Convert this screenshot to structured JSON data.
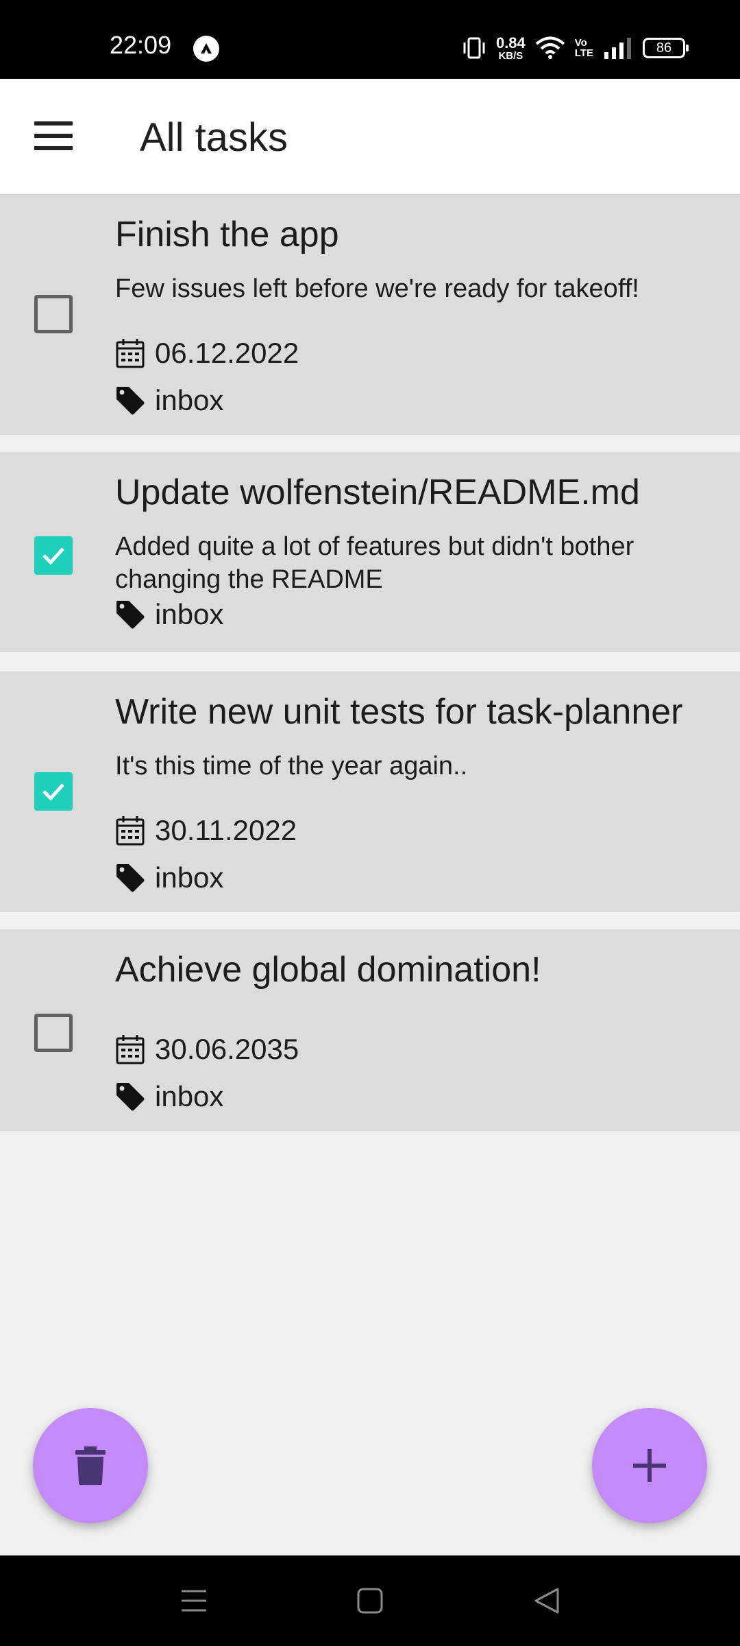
{
  "status_bar": {
    "time": "22:09",
    "net_speed_value": "0.84",
    "net_speed_unit": "KB/S",
    "volte_top": "Vo",
    "volte_bottom": "LTE",
    "battery": "86",
    "icons": [
      "app-notification-icon",
      "vibrate-icon",
      "wifi-icon",
      "signal-icon",
      "battery-icon"
    ]
  },
  "app_bar": {
    "title": "All tasks",
    "menu_icon": "hamburger-menu-icon"
  },
  "tasks": [
    {
      "title": "Finish the app",
      "description": "Few issues left before we're ready for takeoff!",
      "checked": false,
      "date": "06.12.2022",
      "tag": "inbox"
    },
    {
      "title": "Update wolfenstein/README.md",
      "description": "Added quite a lot of features but didn't bother changing the README",
      "checked": true,
      "tag": "inbox"
    },
    {
      "title": "Write new unit tests for task-planner",
      "description": "It's this time of the year again..",
      "checked": true,
      "date": "30.11.2022",
      "tag": "inbox"
    },
    {
      "title": "Achieve global domination!",
      "checked": false,
      "date": "30.06.2035",
      "tag": "inbox"
    }
  ],
  "fabs": {
    "delete_icon": "trash-icon",
    "add_icon": "plus-icon"
  },
  "colors": {
    "accent_check": "#1fd1bd",
    "fab": "#c48af8",
    "fab_icon": "#4a3574",
    "card": "#dcdcdc",
    "background": "#f0f0f0"
  },
  "nav_bar": {
    "icons": [
      "recents-icon",
      "home-icon",
      "back-icon"
    ]
  }
}
